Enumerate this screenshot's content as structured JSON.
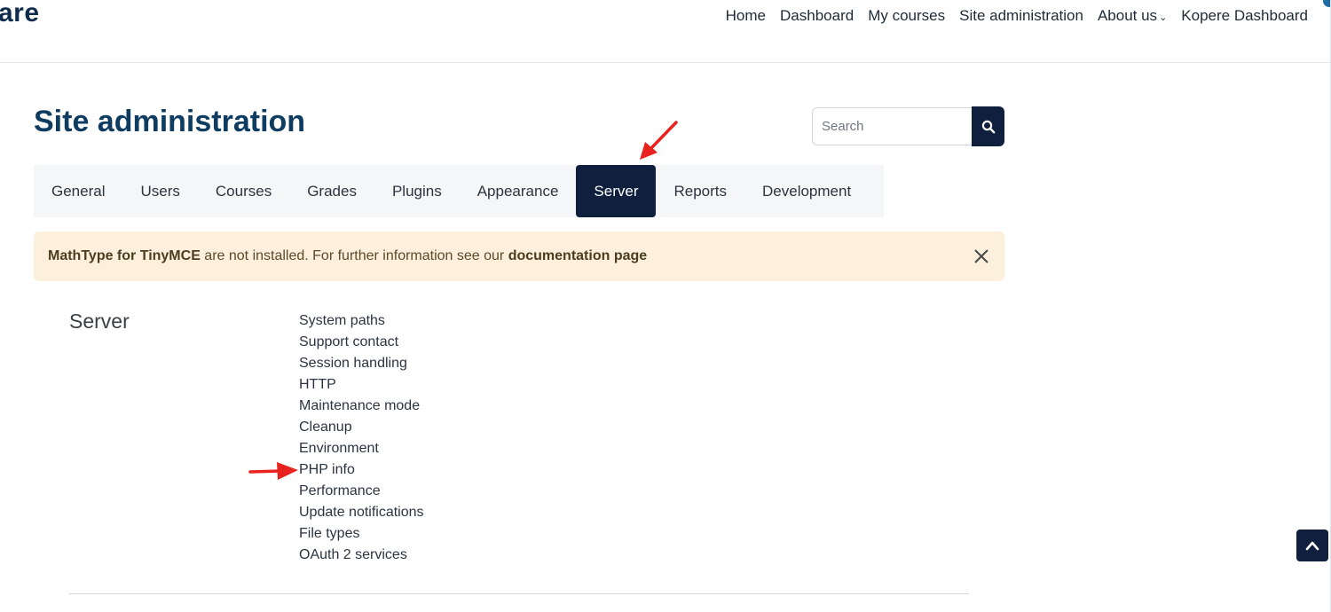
{
  "brand": {
    "text": "are"
  },
  "nav": {
    "items": [
      {
        "label": "Home"
      },
      {
        "label": "Dashboard"
      },
      {
        "label": "My courses"
      },
      {
        "label": "Site administration"
      },
      {
        "label": "About us",
        "has_dropdown": true
      },
      {
        "label": "Kopere Dashboard"
      }
    ]
  },
  "page": {
    "title": "Site administration"
  },
  "search": {
    "placeholder": "Search",
    "value": "",
    "button_icon": "search-icon"
  },
  "tabs": [
    {
      "label": "General",
      "active": false
    },
    {
      "label": "Users",
      "active": false
    },
    {
      "label": "Courses",
      "active": false
    },
    {
      "label": "Grades",
      "active": false
    },
    {
      "label": "Plugins",
      "active": false
    },
    {
      "label": "Appearance",
      "active": false
    },
    {
      "label": "Server",
      "active": true
    },
    {
      "label": "Reports",
      "active": false
    },
    {
      "label": "Development",
      "active": false
    }
  ],
  "alert": {
    "strong_prefix": "MathType for TinyMCE",
    "text": " are not installed. For further information see our ",
    "link": "documentation page",
    "close_icon": "close-icon"
  },
  "section": {
    "title": "Server",
    "links": [
      "System paths",
      "Support contact",
      "Session handling",
      "HTTP",
      "Maintenance mode",
      "Cleanup",
      "Environment",
      "PHP info",
      "Performance",
      "Update notifications",
      "File types",
      "OAuth 2 services"
    ]
  },
  "annotations": {
    "arrow_color": "#e8231f",
    "arrow_targets": [
      "tab-server",
      "link-php-info"
    ]
  },
  "colors": {
    "brand": "#0f3d62",
    "active_tab": "#0f1f3d",
    "alert_bg": "#fcefdc"
  },
  "back_to_top": {
    "icon": "chevron-up-icon"
  }
}
